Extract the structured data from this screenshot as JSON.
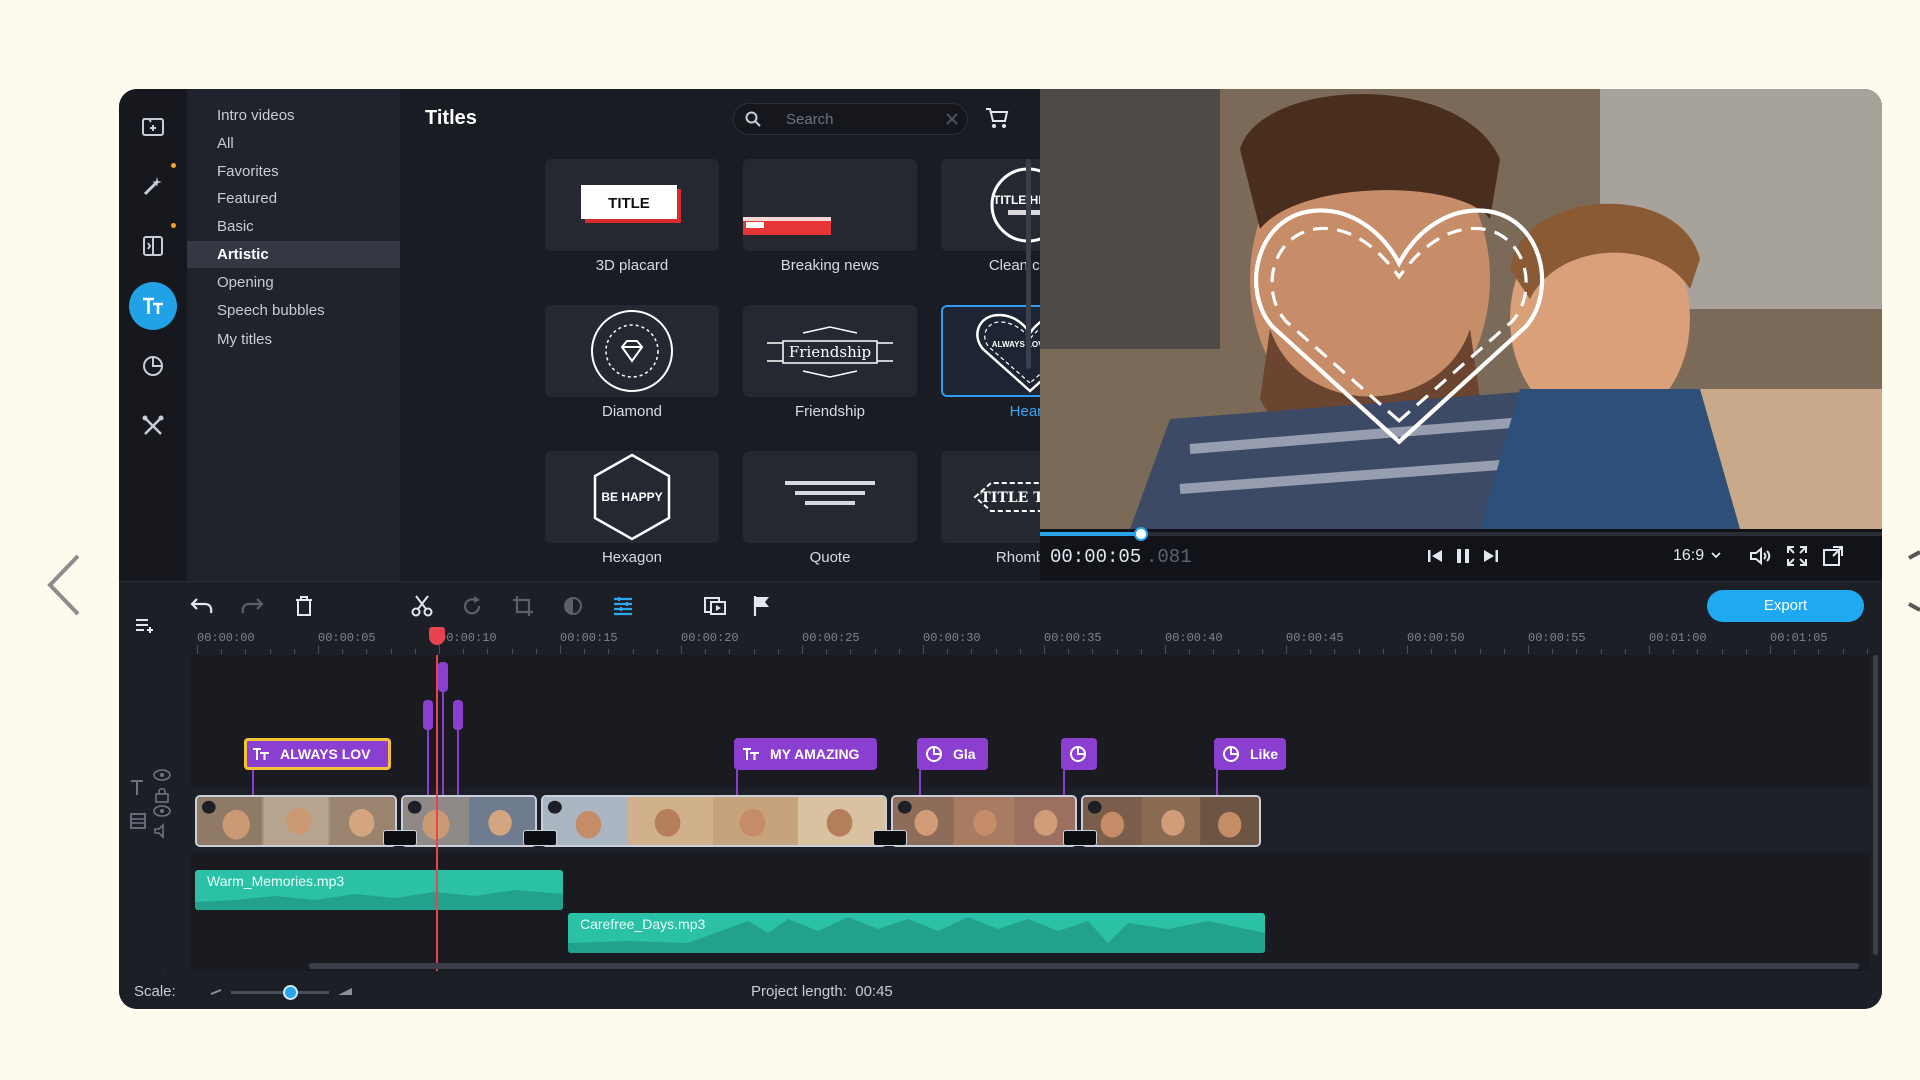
{
  "categories": {
    "items": [
      "Intro videos",
      "All",
      "Favorites",
      "Featured",
      "Basic",
      "Artistic",
      "Opening",
      "Speech bubbles",
      "My titles"
    ],
    "active": "Artistic"
  },
  "titles_panel": {
    "heading": "Titles",
    "search_placeholder": "Search",
    "tiles": [
      {
        "name": "3D placard",
        "preview_text": "TITLE"
      },
      {
        "name": "Breaking news",
        "preview_text": ""
      },
      {
        "name": "Clean circle",
        "preview_text": "TITLE HERE"
      },
      {
        "name": "Diamond",
        "preview_text": ""
      },
      {
        "name": "Friendship",
        "preview_text": "Friendship"
      },
      {
        "name": "Heart",
        "preview_text": "ALWAYS LOVE YOU"
      },
      {
        "name": "Hexagon",
        "preview_text": "BE HAPPY"
      },
      {
        "name": "Quote",
        "preview_text": ""
      },
      {
        "name": "Rhombus",
        "preview_text": "TITLE TEXT"
      }
    ],
    "selected": "Heart"
  },
  "player": {
    "timecode": "00:00:05",
    "timecode_frames": ".081",
    "progress_fraction": 0.12,
    "aspect_ratio": "16:9"
  },
  "toolbar": {
    "export_label": "Export"
  },
  "timeline": {
    "ruler_labels": [
      "00:00:00",
      "00:00:05",
      "00:00:10",
      "00:00:15",
      "00:00:20",
      "00:00:25",
      "00:00:30",
      "00:00:35",
      "00:00:40",
      "00:00:45",
      "00:00:50",
      "00:00:55",
      "00:01:00",
      "00:01:05"
    ],
    "title_clips": [
      "ALWAYS LOV",
      "MY AMAZING",
      "Gla",
      "",
      "Like"
    ],
    "audio_clips": [
      "Warm_Memories.mp3",
      "Carefree_Days.mp3"
    ]
  },
  "footer": {
    "scale_label": "Scale:",
    "project_length": "Project length:  00:45",
    "scale_fraction": 0.6
  },
  "colors": {
    "accent": "#22a2e6",
    "title_clip": "#8b3fd0",
    "audio_clip": "#2bc1a7",
    "playhead": "#e8434f",
    "selected_clip_border": "#f3c431"
  }
}
